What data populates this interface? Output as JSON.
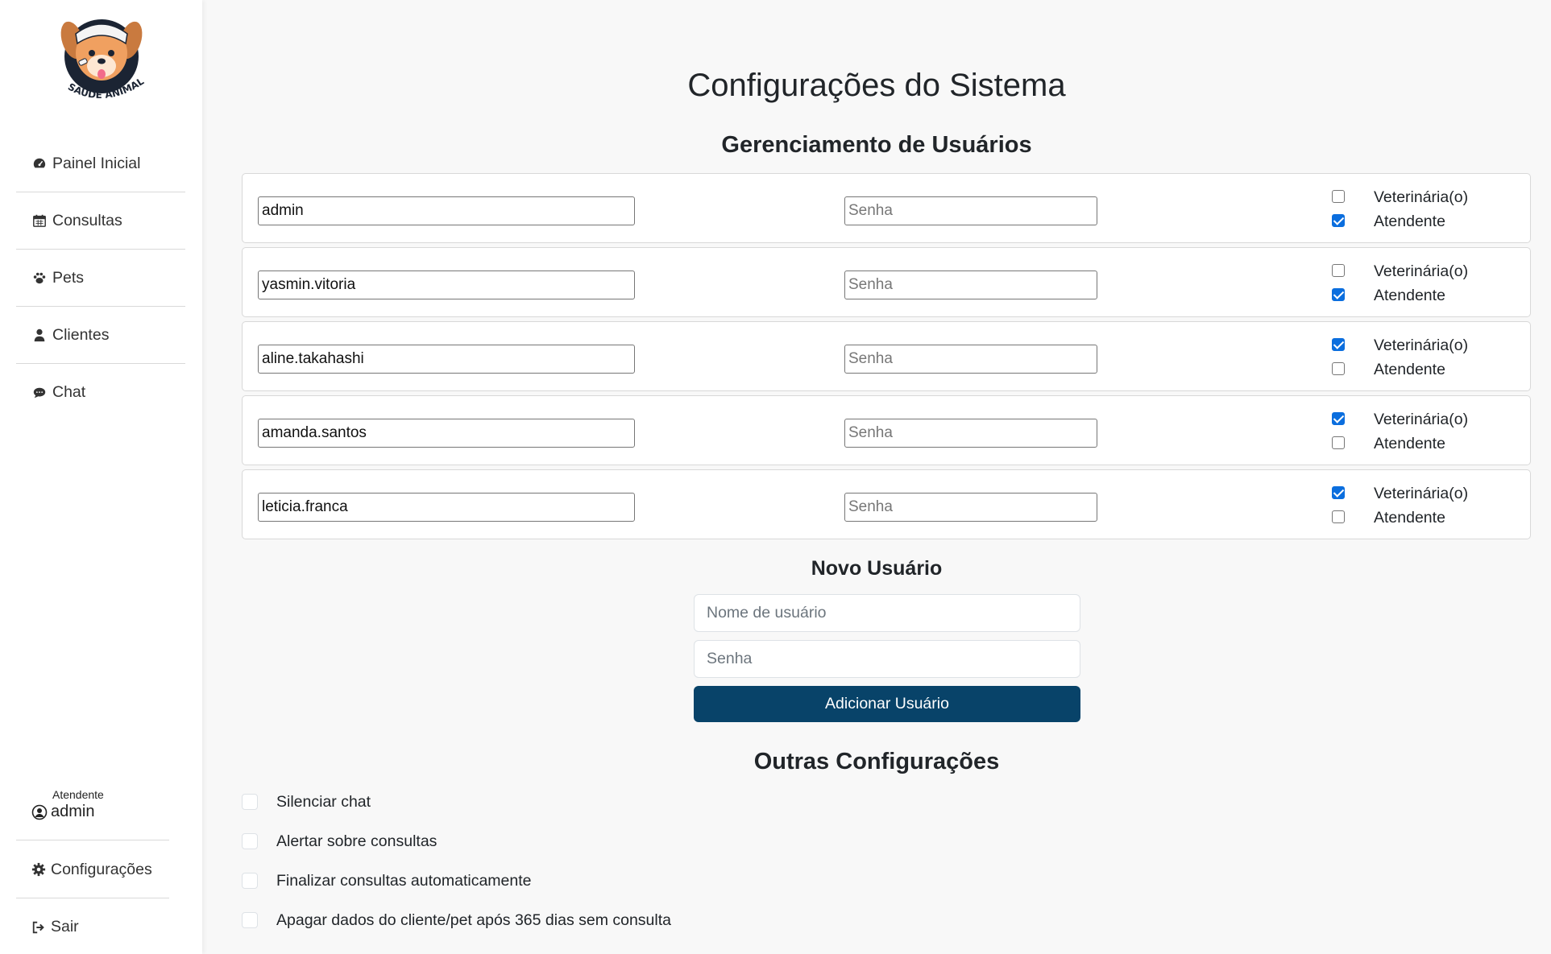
{
  "brand": {
    "logo_text": "SAÚDE ANIMAL"
  },
  "nav": [
    {
      "label": "Painel Inicial",
      "icon": "dashboard-icon"
    },
    {
      "label": "Consultas",
      "icon": "calendar-icon"
    },
    {
      "label": "Pets",
      "icon": "paw-icon"
    },
    {
      "label": "Clientes",
      "icon": "user-icon"
    },
    {
      "label": "Chat",
      "icon": "chat-icon"
    }
  ],
  "current_user": {
    "role": "Atendente",
    "name": "admin"
  },
  "bottom_nav": {
    "settings": "Configurações",
    "logout": "Sair"
  },
  "page": {
    "title": "Configurações do Sistema",
    "users_section_title": "Gerenciamento de Usuários",
    "password_placeholder": "Senha",
    "role_vet_label": "Veterinária(o)",
    "role_attendant_label": "Atendente"
  },
  "users": [
    {
      "username": "admin",
      "vet": false,
      "attendant": true
    },
    {
      "username": "yasmin.vitoria",
      "vet": false,
      "attendant": true
    },
    {
      "username": "aline.takahashi",
      "vet": true,
      "attendant": false
    },
    {
      "username": "amanda.santos",
      "vet": true,
      "attendant": false
    },
    {
      "username": "leticia.franca",
      "vet": true,
      "attendant": false
    }
  ],
  "new_user": {
    "title": "Novo Usuário",
    "username_placeholder": "Nome de usuário",
    "password_placeholder": "Senha",
    "button_label": "Adicionar Usuário"
  },
  "other_settings": {
    "title": "Outras Configurações",
    "options": [
      {
        "label": "Silenciar chat",
        "checked": false
      },
      {
        "label": "Alertar sobre consultas",
        "checked": false
      },
      {
        "label": "Finalizar consultas automaticamente",
        "checked": false
      },
      {
        "label": "Apagar dados do cliente/pet após 365 dias sem consulta",
        "checked": false
      }
    ]
  },
  "colors": {
    "primary_button": "#084369",
    "checkbox_checked": "#0b6ede",
    "background": "#f8f8f8",
    "sidebar": "#ffffff"
  }
}
